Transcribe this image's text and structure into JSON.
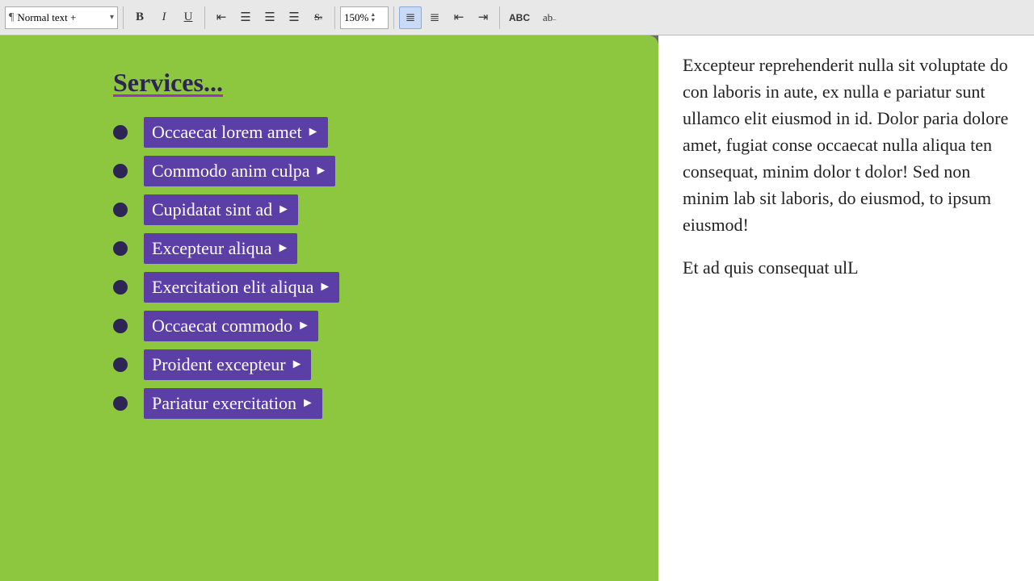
{
  "toolbar": {
    "style_label": "Normal text +",
    "para_icon": "¶",
    "bold": "B",
    "italic": "I",
    "underline": "U",
    "align_left": "≡",
    "align_center": "≡",
    "align_right": "≡",
    "align_justify": "≡",
    "strikethrough": "S",
    "zoom_value": "150%",
    "list_unordered": "☰",
    "list_ordered": "☰",
    "indent_decrease": "⇤",
    "indent_increase": "⇥",
    "spell_abc": "ABC",
    "style_ab": "ab",
    "dropdown_arrow": "▾"
  },
  "doc": {
    "title": "Services...",
    "items": [
      "Occaecat lorem amet",
      "Commodo anim culpa",
      "Cupidatat sint ad",
      "Excepteur aliqua",
      "Exercitation elit aliqua",
      "Occaecat commodo",
      "Proident excepteur",
      "Pariatur exercitation"
    ]
  },
  "right_text": {
    "para1": "Excepteur reprehenderit nulla sit voluptate do con laboris in aute, ex nulla e pariatur sunt ullamco elit eiusmod in id. Dolor paria dolore amet, fugiat conse occaecat nulla aliqua ten consequat, minim dolor t dolor! Sed non minim lab sit laboris, do eiusmod, to ipsum eiusmod!",
    "para2": "Et ad quis consequat ulL"
  }
}
